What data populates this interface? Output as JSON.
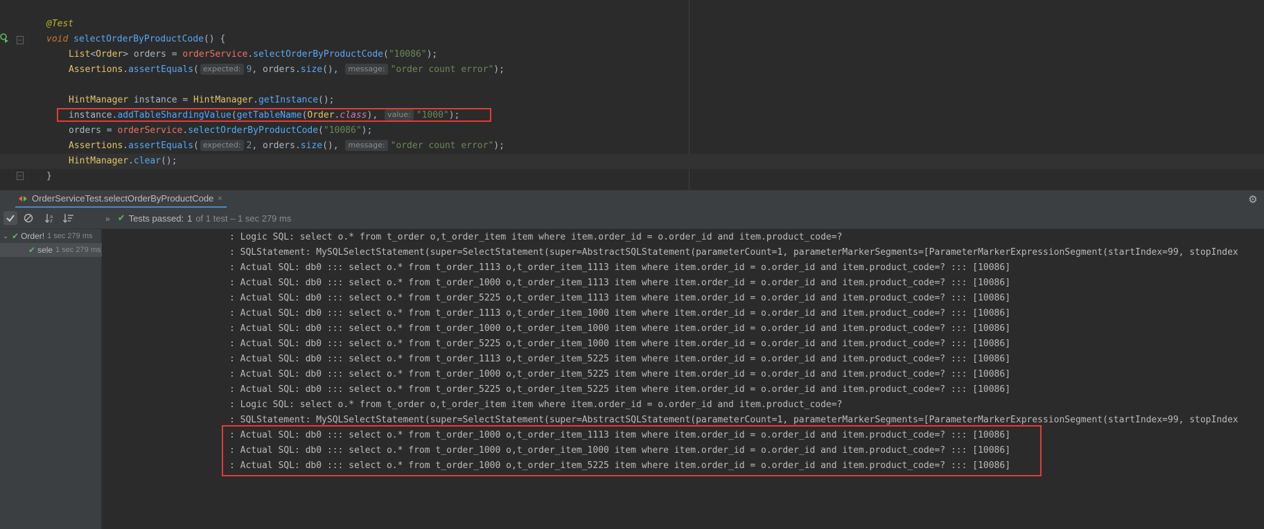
{
  "editor": {
    "lines": [
      {
        "id": "l1"
      },
      {
        "id": "l2"
      }
    ],
    "code": {
      "annotation": "@Test",
      "void_kw": "void",
      "method_name": "selectOrderByProductCode",
      "sig_tail": "() {",
      "l3_list": "List",
      "l3_lt": "<",
      "l3_order": "Order",
      "l3_gt": ">",
      "l3_orders": " orders = ",
      "l3_service": "orderService",
      "l3_dot": ".",
      "l3_call": "selectOrderByProductCode",
      "l3_open": "(",
      "l3_arg": "\"10086\"",
      "l3_close": ");",
      "assertions": "Assertions",
      "assert_equals": "assertEquals",
      "hint_expected": "expected:",
      "hint_message": "message:",
      "hint_value": "value:",
      "l4_expected": "9",
      "comma_orders": ", orders.",
      "size": "size",
      "size_tail": "(),",
      "msg_str": "\"order count error\"",
      "close_paren": ");",
      "hint_manager": "HintManager",
      "l6_instance": " instance = ",
      "get_instance": "getInstance",
      "paren_semi": "();",
      "l7_instance": "instance.",
      "add_table": "addTableShardingValue",
      "get_table_name": "getTableName",
      "order": "Order",
      "class_kw": "class",
      "l7_mid": "),",
      "l7_val": "\"1000\"",
      "l8_orders": "orders = ",
      "l8_service": "orderService",
      "l9_expected": "2",
      "clear": "clear",
      "closing_brace": "}"
    }
  },
  "test_tab": {
    "label": "OrderServiceTest.selectOrderByProductCode",
    "close": "×"
  },
  "toolbar": {
    "status_prefix": "Tests passed:",
    "passed_count": "1",
    "status_suffix": "of 1 test – 1 sec 279 ms",
    "chevron": "»"
  },
  "tree": {
    "root": {
      "label": "Order!",
      "time": "1 sec 279 ms"
    },
    "child": {
      "label": "sele",
      "time": "1 sec 279 ms"
    }
  },
  "console": {
    "lines": [
      ": Logic SQL: select o.* from t_order o,t_order_item item where item.order_id = o.order_id and item.product_code=?",
      ": SQLStatement: MySQLSelectStatement(super=SelectStatement(super=AbstractSQLStatement(parameterCount=1, parameterMarkerSegments=[ParameterMarkerExpressionSegment(startIndex=99, stopIndex",
      ": Actual SQL: db0 ::: select o.* from t_order_1113 o,t_order_item_1113 item where item.order_id = o.order_id and item.product_code=? ::: [10086]",
      ": Actual SQL: db0 ::: select o.* from t_order_1000 o,t_order_item_1113 item where item.order_id = o.order_id and item.product_code=? ::: [10086]",
      ": Actual SQL: db0 ::: select o.* from t_order_5225 o,t_order_item_1113 item where item.order_id = o.order_id and item.product_code=? ::: [10086]",
      ": Actual SQL: db0 ::: select o.* from t_order_1113 o,t_order_item_1000 item where item.order_id = o.order_id and item.product_code=? ::: [10086]",
      ": Actual SQL: db0 ::: select o.* from t_order_1000 o,t_order_item_1000 item where item.order_id = o.order_id and item.product_code=? ::: [10086]",
      ": Actual SQL: db0 ::: select o.* from t_order_5225 o,t_order_item_1000 item where item.order_id = o.order_id and item.product_code=? ::: [10086]",
      ": Actual SQL: db0 ::: select o.* from t_order_1113 o,t_order_item_5225 item where item.order_id = o.order_id and item.product_code=? ::: [10086]",
      ": Actual SQL: db0 ::: select o.* from t_order_1000 o,t_order_item_5225 item where item.order_id = o.order_id and item.product_code=? ::: [10086]",
      ": Actual SQL: db0 ::: select o.* from t_order_5225 o,t_order_item_5225 item where item.order_id = o.order_id and item.product_code=? ::: [10086]",
      ": Logic SQL: select o.* from t_order o,t_order_item item where item.order_id = o.order_id and item.product_code=?",
      ": SQLStatement: MySQLSelectStatement(super=SelectStatement(super=AbstractSQLStatement(parameterCount=1, parameterMarkerSegments=[ParameterMarkerExpressionSegment(startIndex=99, stopIndex",
      ": Actual SQL: db0 ::: select o.* from t_order_1000 o,t_order_item_1113 item where item.order_id = o.order_id and item.product_code=? ::: [10086]",
      ": Actual SQL: db0 ::: select o.* from t_order_1000 o,t_order_item_1000 item where item.order_id = o.order_id and item.product_code=? ::: [10086]",
      ": Actual SQL: db0 ::: select o.* from t_order_1000 o,t_order_item_5225 item where item.order_id = o.order_id and item.product_code=? ::: [10086]"
    ]
  },
  "colors": {
    "highlight_box": "#e33b3b",
    "pass_green": "#5fb760",
    "tab_underline": "#4a88c7"
  },
  "icons": [
    "run-test-icon",
    "fold-icon",
    "gear-icon",
    "check-icon",
    "stop-icon",
    "sort-alpha-icon",
    "sort-duration-icon",
    "expand-chevron-icon",
    "close-icon"
  ]
}
